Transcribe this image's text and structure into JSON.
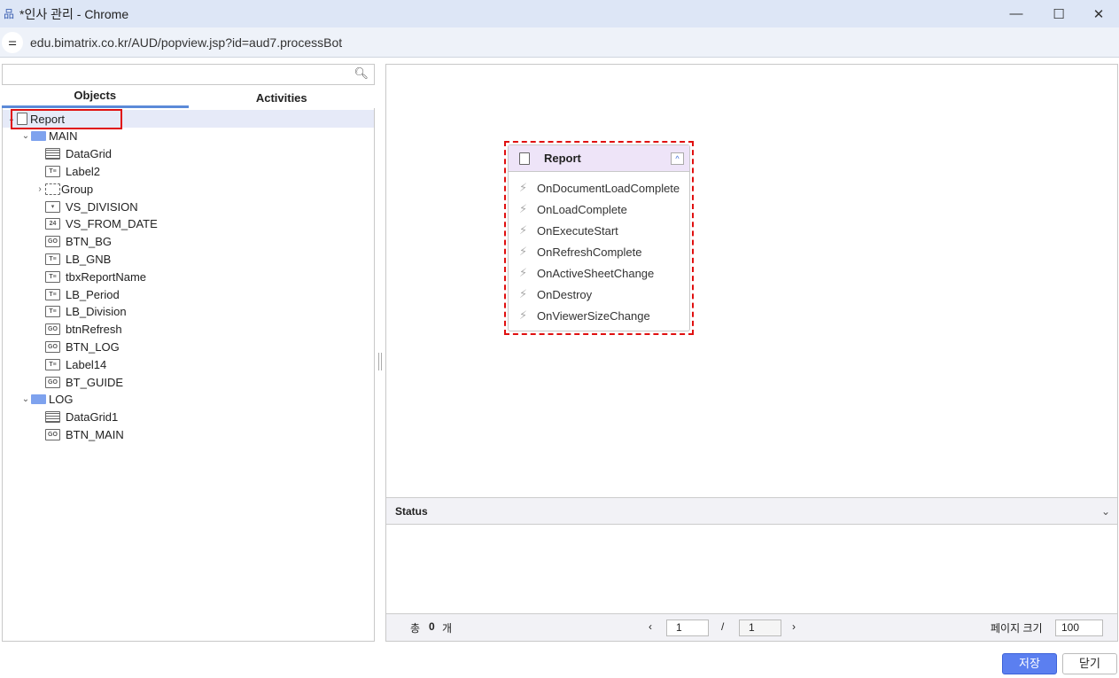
{
  "window": {
    "title": "*인사 관리 - Chrome",
    "url": "edu.bimatrix.co.kr/AUD/popview.jsp?id=aud7.processBot",
    "minimize": "—",
    "maximize": "☐",
    "close": "✕"
  },
  "left": {
    "search_placeholder": "",
    "tabs": [
      {
        "label": "Objects",
        "active": true
      },
      {
        "label": "Activities",
        "active": false
      }
    ],
    "tree": [
      {
        "label": "Report",
        "icon": "doc",
        "level": 0,
        "toggle": "⌄",
        "selected": true
      },
      {
        "label": "MAIN",
        "icon": "folder",
        "level": 1,
        "toggle": "⌄"
      },
      {
        "label": "DataGrid",
        "icon": "grid",
        "level": 2,
        "toggle": ""
      },
      {
        "label": "Label2",
        "icon": "label",
        "level": 2,
        "toggle": ""
      },
      {
        "label": "Group",
        "icon": "group",
        "level": 2,
        "toggle": "›"
      },
      {
        "label": "VS_DIVISION",
        "icon": "combo",
        "level": 2,
        "toggle": ""
      },
      {
        "label": "VS_FROM_DATE",
        "icon": "date",
        "level": 2,
        "toggle": ""
      },
      {
        "label": "BTN_BG",
        "icon": "button",
        "level": 2,
        "toggle": ""
      },
      {
        "label": "LB_GNB",
        "icon": "label",
        "level": 2,
        "toggle": ""
      },
      {
        "label": "tbxReportName",
        "icon": "label",
        "level": 2,
        "toggle": ""
      },
      {
        "label": "LB_Period",
        "icon": "label",
        "level": 2,
        "toggle": ""
      },
      {
        "label": "LB_Division",
        "icon": "label",
        "level": 2,
        "toggle": ""
      },
      {
        "label": "btnRefresh",
        "icon": "button",
        "level": 2,
        "toggle": ""
      },
      {
        "label": "BTN_LOG",
        "icon": "button",
        "level": 2,
        "toggle": ""
      },
      {
        "label": "Label14",
        "icon": "label",
        "level": 2,
        "toggle": ""
      },
      {
        "label": "BT_GUIDE",
        "icon": "button",
        "level": 2,
        "toggle": ""
      },
      {
        "label": "LOG",
        "icon": "folder",
        "level": 1,
        "toggle": "⌄"
      },
      {
        "label": "DataGrid1",
        "icon": "grid",
        "level": 2,
        "toggle": ""
      },
      {
        "label": "BTN_MAIN",
        "icon": "button",
        "level": 2,
        "toggle": ""
      }
    ]
  },
  "canvas": {
    "node": {
      "title": "Report",
      "events": [
        "OnDocumentLoadComplete",
        "OnLoadComplete",
        "OnExecuteStart",
        "OnRefreshComplete",
        "OnActiveSheetChange",
        "OnDestroy",
        "OnViewerSizeChange"
      ]
    }
  },
  "status": {
    "title": "Status",
    "total_prefix": "총",
    "total": "0",
    "total_suffix": "개",
    "page": "1",
    "sep": "/",
    "page_total": "1",
    "page_size_label": "페이지 크기",
    "page_size": "100"
  },
  "buttons": {
    "save": "저장",
    "close": "닫기"
  },
  "colors": {
    "accent": "#5b7ff0",
    "highlight": "#e01010"
  }
}
